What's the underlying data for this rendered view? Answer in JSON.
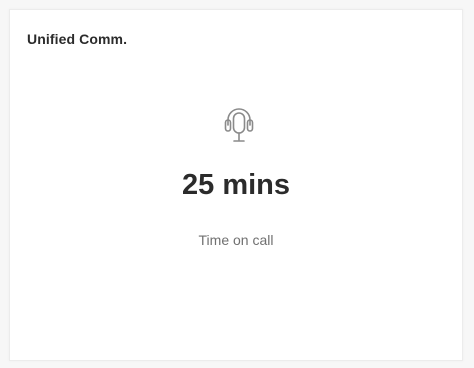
{
  "widget": {
    "title": "Unified Comm.",
    "icon": "headset-icon",
    "value": "25 mins",
    "label": "Time on call"
  },
  "colors": {
    "title": "#2b2b2b",
    "value": "#2b2b2b",
    "label": "#707070",
    "icon": "#8a8a8a",
    "card_background": "#ffffff",
    "page_background": "#f7f7f7"
  }
}
